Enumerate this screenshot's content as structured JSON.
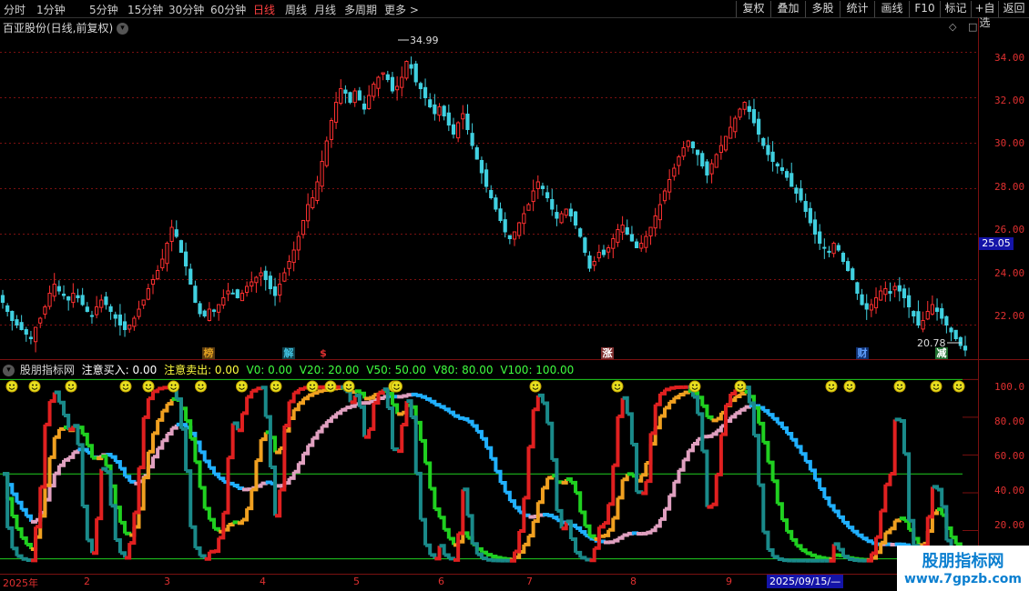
{
  "toolbar": {
    "periods": [
      "分时",
      "1分钟",
      "5分钟",
      "15分钟",
      "30分钟",
      "60分钟",
      "日线",
      "周线",
      "月线",
      "多周期",
      "更多 >"
    ],
    "active_period": "日线",
    "right_buttons": [
      "复权",
      "叠加",
      "多股",
      "统计",
      "画线",
      "F10",
      "标记",
      "+自选",
      "返回"
    ]
  },
  "chart_title": "百亚股份(日线,前复权)",
  "price_axis": {
    "labels": [
      "34.00",
      "32.00",
      "30.00",
      "28.00",
      "26.00",
      "24.00",
      "22.00"
    ],
    "range": [
      20.5,
      35.5
    ]
  },
  "current_price": "25.05",
  "annotations": {
    "high": "34.99",
    "low": "20.78"
  },
  "event_markers": [
    {
      "text": "榜",
      "color": "#e0a020",
      "bg": "#5a3a10"
    },
    {
      "text": "解",
      "color": "#40c0e0",
      "bg": "#10404a"
    },
    {
      "text": "$",
      "color": "#e03030",
      "bg": "#000000"
    },
    {
      "text": "涨",
      "color": "#ffffff",
      "bg": "#803030"
    },
    {
      "text": "财",
      "color": "#60a0ff",
      "bg": "#103070"
    },
    {
      "text": "减",
      "color": "#ffffff",
      "bg": "#207030"
    }
  ],
  "indicator": {
    "name": "股朋指标网",
    "values": [
      {
        "text": "注意买入: 0.00",
        "color": "#ffffff"
      },
      {
        "text": "注意卖出: 0.00",
        "color": "#ffff40"
      },
      {
        "text": "V0: 0.00",
        "color": "#40ff40"
      },
      {
        "text": "V20: 20.00",
        "color": "#40ff40"
      },
      {
        "text": "V50: 50.00",
        "color": "#40ff40"
      },
      {
        "text": "V80: 80.00",
        "color": "#40ff40"
      },
      {
        "text": "V100: 100.00",
        "color": "#40ff40"
      }
    ],
    "axis_labels": [
      "100.0",
      "80.00",
      "60.00",
      "40.00",
      "20.00"
    ],
    "range": [
      0,
      105
    ]
  },
  "x_axis": {
    "labels": [
      "2025年",
      "2",
      "3",
      "4",
      "5",
      "6",
      "7",
      "8",
      "9"
    ],
    "cursor_date": "2025/09/15/—"
  },
  "watermark": {
    "title": "股朋指标网",
    "url": "www.7gpzb.com"
  },
  "colors": {
    "up": "#ff3030",
    "down": "#40d0e0",
    "grid": "#7a1010",
    "ref": "#20d020"
  },
  "chart_data": {
    "type": "candlestick",
    "ylim": [
      20.5,
      35.5
    ],
    "closes": [
      23.0,
      22.6,
      22.2,
      22.0,
      21.8,
      21.6,
      21.4,
      21.9,
      22.3,
      22.8,
      23.4,
      23.8,
      23.5,
      23.3,
      23.1,
      23.4,
      23.2,
      22.9,
      22.6,
      22.4,
      22.8,
      23.1,
      22.9,
      22.6,
      22.3,
      22.0,
      21.8,
      22.0,
      22.3,
      22.7,
      23.1,
      23.6,
      24.0,
      24.4,
      24.9,
      25.6,
      26.3,
      25.9,
      25.2,
      24.6,
      23.8,
      23.0,
      22.5,
      22.4,
      22.7,
      22.6,
      22.9,
      23.2,
      23.5,
      23.4,
      23.2,
      23.4,
      23.7,
      23.9,
      24.1,
      24.3,
      24.0,
      23.6,
      23.3,
      23.8,
      24.3,
      24.8,
      25.3,
      25.9,
      26.6,
      27.3,
      27.6,
      28.3,
      29.2,
      30.1,
      31.0,
      31.8,
      32.4,
      32.2,
      31.8,
      32.3,
      31.9,
      31.5,
      32.1,
      32.6,
      32.9,
      33.1,
      32.8,
      32.3,
      32.5,
      32.9,
      33.6,
      33.3,
      32.7,
      32.4,
      32.0,
      31.6,
      31.3,
      31.6,
      31.2,
      30.8,
      30.4,
      30.9,
      31.3,
      30.6,
      29.9,
      29.3,
      28.7,
      28.1,
      27.6,
      27.1,
      26.6,
      26.1,
      25.8,
      26.1,
      26.5,
      26.9,
      27.3,
      27.9,
      28.3,
      28.0,
      27.6,
      27.1,
      26.7,
      26.9,
      27.1,
      26.8,
      26.4,
      25.9,
      25.2,
      24.5,
      24.8,
      25.2,
      25.1,
      25.4,
      25.8,
      26.2,
      26.4,
      26.0,
      25.7,
      25.4,
      25.6,
      25.9,
      26.3,
      26.8,
      27.3,
      27.9,
      28.4,
      28.9,
      29.4,
      29.8,
      30.1,
      29.8,
      29.5,
      29.0,
      28.6,
      29.1,
      29.5,
      29.9,
      30.3,
      30.7,
      31.1,
      31.5,
      31.8,
      31.4,
      30.9,
      30.4,
      29.9,
      29.5,
      29.2,
      29.0,
      28.8,
      28.5,
      28.1,
      27.8,
      27.5,
      27.0,
      26.5,
      26.0,
      25.6,
      25.4,
      25.2,
      25.6,
      25.3,
      24.8,
      24.4,
      24.0,
      23.4,
      22.9,
      22.7,
      22.9,
      23.2,
      23.5,
      23.6,
      23.4,
      23.7,
      23.5,
      23.2,
      22.8,
      22.4,
      22.0,
      22.2,
      22.6,
      22.9,
      22.6,
      22.3,
      22.0,
      21.7,
      21.4,
      21.1,
      20.9
    ]
  }
}
